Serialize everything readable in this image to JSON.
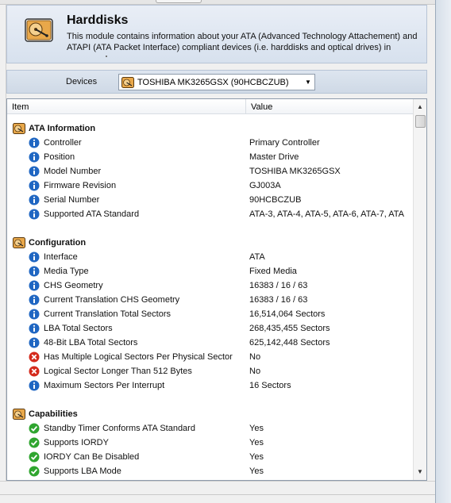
{
  "header": {
    "title": "Harddisks",
    "description": "This module contains information about your ATA (Advanced Technology Attachement) and ATAPI (ATA Packet Interface) compliant devices (i.e. harddisks and optical drives) in",
    "icon": "harddisk-icon"
  },
  "devices": {
    "label": "Devices",
    "selected": "TOSHIBA MK3265GSX (90HCBCZUB)"
  },
  "columns": {
    "item": "Item",
    "value": "Value"
  },
  "colors": {
    "info": "#1f66c2",
    "error": "#d42a1c",
    "ok": "#2fa52f",
    "header_bg": "#dde5ef"
  },
  "sections": [
    {
      "title": "ATA Information",
      "rows": [
        {
          "icon": "info",
          "label": "Controller",
          "value": "Primary Controller"
        },
        {
          "icon": "info",
          "label": "Position",
          "value": "Master Drive"
        },
        {
          "icon": "info",
          "label": "Model Number",
          "value": "TOSHIBA MK3265GSX"
        },
        {
          "icon": "info",
          "label": "Firmware Revision",
          "value": "GJ003A"
        },
        {
          "icon": "info",
          "label": "Serial Number",
          "value": "90HCBCZUB"
        },
        {
          "icon": "info",
          "label": "Supported ATA Standard",
          "value": "ATA-3, ATA-4, ATA-5, ATA-6, ATA-7, ATA"
        }
      ]
    },
    {
      "title": "Configuration",
      "rows": [
        {
          "icon": "info",
          "label": "Interface",
          "value": "ATA"
        },
        {
          "icon": "info",
          "label": "Media Type",
          "value": "Fixed Media"
        },
        {
          "icon": "info",
          "label": "CHS Geometry",
          "value": "16383 / 16 / 63"
        },
        {
          "icon": "info",
          "label": "Current Translation CHS Geometry",
          "value": "16383 / 16 / 63"
        },
        {
          "icon": "info",
          "label": "Current Translation Total Sectors",
          "value": "16,514,064 Sectors"
        },
        {
          "icon": "info",
          "label": "LBA Total Sectors",
          "value": "268,435,455 Sectors"
        },
        {
          "icon": "info",
          "label": "48-Bit LBA Total Sectors",
          "value": "625,142,448 Sectors"
        },
        {
          "icon": "error",
          "label": "Has Multiple Logical Sectors Per Physical Sector",
          "value": "No"
        },
        {
          "icon": "error",
          "label": "Logical Sector Longer Than 512 Bytes",
          "value": "No"
        },
        {
          "icon": "info",
          "label": "Maximum Sectors Per Interrupt",
          "value": "16 Sectors"
        }
      ]
    },
    {
      "title": "Capabilities",
      "rows": [
        {
          "icon": "ok",
          "label": "Standby Timer Conforms ATA Standard",
          "value": "Yes"
        },
        {
          "icon": "ok",
          "label": "Supports IORDY",
          "value": "Yes"
        },
        {
          "icon": "ok",
          "label": "IORDY Can Be Disabled",
          "value": "Yes"
        },
        {
          "icon": "ok",
          "label": "Supports LBA Mode",
          "value": "Yes"
        }
      ]
    }
  ]
}
